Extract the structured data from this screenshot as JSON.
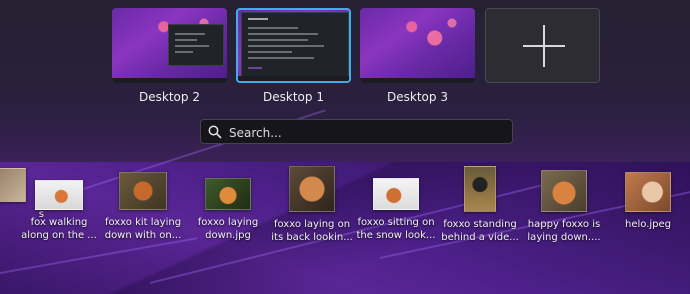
{
  "desktops": [
    {
      "label": "Desktop 2",
      "active": false
    },
    {
      "label": "Desktop 1",
      "active": true
    },
    {
      "label": "Desktop 3",
      "active": false
    }
  ],
  "add_desktop_icon": "plus-icon",
  "search": {
    "placeholder": "Search...",
    "value": "",
    "icon": "search-icon"
  },
  "files": [
    {
      "name": "s"
    },
    {
      "name": "fox walking along on the ..."
    },
    {
      "name": "foxxo kit laying down with on..."
    },
    {
      "name": "foxxo laying down.jpg"
    },
    {
      "name": "foxxo laying on its back lookin..."
    },
    {
      "name": "foxxo sitting on the snow look..."
    },
    {
      "name": "foxxo standing behind a vide..."
    },
    {
      "name": "happy foxxo is laying down...."
    },
    {
      "name": "helo.jpeg"
    }
  ],
  "colors": {
    "accent": "#3daee9",
    "panel": "#16151b",
    "wallpaper": "#4b1f7a"
  }
}
